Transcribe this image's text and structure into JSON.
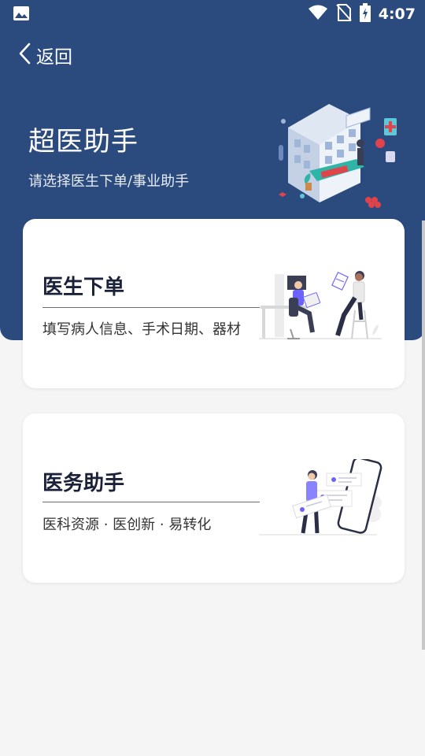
{
  "status_bar": {
    "time": "4:07",
    "left_icon": "image-icon",
    "icons": [
      "wifi-icon",
      "no-sim-icon",
      "battery-charging-icon"
    ]
  },
  "nav": {
    "back_label": "返回",
    "back_icon": "chevron-left-icon"
  },
  "hero": {
    "title": "超医助手",
    "subtitle": "请选择医生下单/事业助手"
  },
  "cards": [
    {
      "title": "医生下单",
      "description": "填写病人信息、手术日期、器材"
    },
    {
      "title": "医务助手",
      "description": "医科资源 · 医创新 · 易转化"
    }
  ],
  "colors": {
    "header_bg": "#2b4a7e",
    "card_title": "#1a2138",
    "accent": "#6c63ff",
    "page_bg": "#f5f5f5"
  }
}
